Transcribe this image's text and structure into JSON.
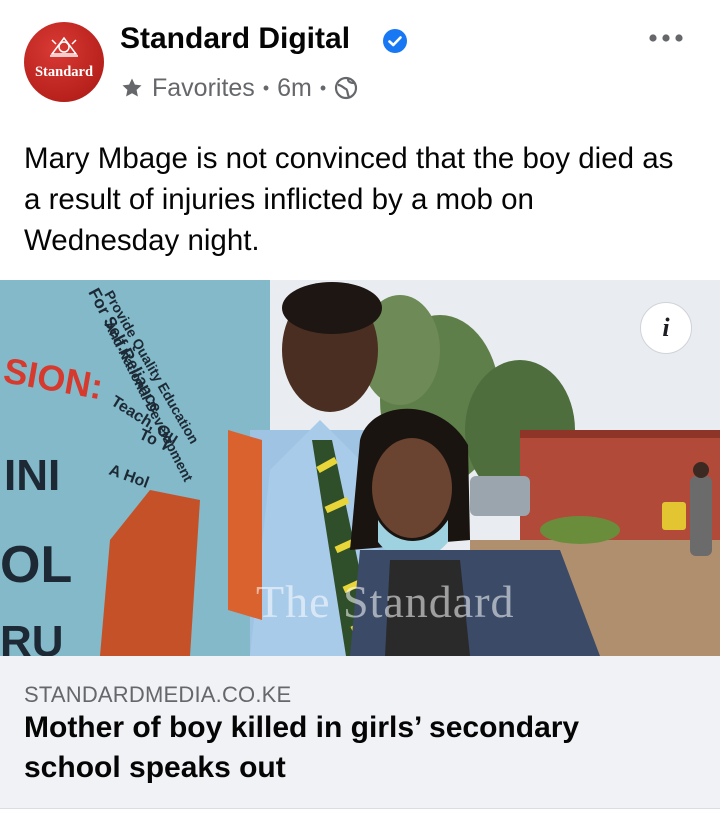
{
  "header": {
    "logo_text": "Standard",
    "page_name": "Standard Digital",
    "verified": true,
    "audience": "Favorites",
    "time": "6m",
    "separator": "•"
  },
  "post": {
    "caption": "Mary Mbage is not convinced that the boy died as a result of injuries inflicted by a mob on Wednesday night."
  },
  "image": {
    "wall_text": [
      "Provide Quality Education",
      "For Self.Reliance",
      "And National Development",
      "SION:",
      "Teach, Gu",
      "To T",
      "A Hol",
      "INI",
      "OL",
      "RU"
    ],
    "watermark": "The Standard",
    "info_glyph": "i"
  },
  "link": {
    "domain": "STANDARDMEDIA.CO.KE",
    "title": "Mother of boy killed in girls’ secondary school speaks out"
  },
  "colors": {
    "brand_red": "#c4231d",
    "verified_blue": "#1877f2",
    "secondary_text": "#65676b",
    "link_bg": "#f0f2f5"
  },
  "icons": {
    "audience": "star-icon",
    "privacy": "globe-icon",
    "verified": "verified-check-icon",
    "more": "more-options-icon",
    "info": "info-icon"
  }
}
